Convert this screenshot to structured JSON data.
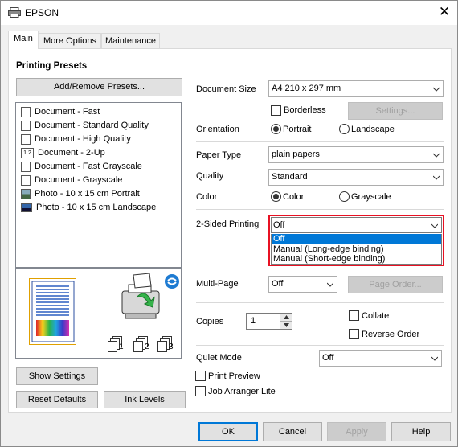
{
  "window": {
    "title": "EPSON",
    "close_label": "✕"
  },
  "tabs": [
    {
      "label": "Main"
    },
    {
      "label": "More Options"
    },
    {
      "label": "Maintenance"
    }
  ],
  "presets": {
    "heading": "Printing Presets",
    "add_remove_label": "Add/Remove Presets...",
    "items": [
      {
        "label": "Document - Fast",
        "icon": "document-icon"
      },
      {
        "label": "Document - Standard Quality",
        "icon": "document-icon"
      },
      {
        "label": "Document - High Quality",
        "icon": "document-icon"
      },
      {
        "label": "Document - 2-Up",
        "icon": "two-up-icon",
        "icon_text": "1 2"
      },
      {
        "label": "Document - Fast Grayscale",
        "icon": "document-icon"
      },
      {
        "label": "Document - Grayscale",
        "icon": "document-icon"
      },
      {
        "label": "Photo - 10 x 15 cm Portrait",
        "icon": "photo-portrait-icon"
      },
      {
        "label": "Photo - 10 x 15 cm Landscape",
        "icon": "photo-landscape-icon"
      }
    ]
  },
  "preview": {
    "copy_numbers": [
      "1",
      "2",
      "3"
    ]
  },
  "settings": {
    "document_size": {
      "label": "Document Size",
      "value": "A4 210 x 297 mm"
    },
    "borderless": {
      "label": "Borderless",
      "checked": false
    },
    "settings_button": "Settings...",
    "orientation": {
      "label": "Orientation",
      "options": [
        "Portrait",
        "Landscape"
      ],
      "selected": "Portrait"
    },
    "paper_type": {
      "label": "Paper Type",
      "value": "plain papers"
    },
    "quality": {
      "label": "Quality",
      "value": "Standard"
    },
    "color": {
      "label": "Color",
      "options": [
        "Color",
        "Grayscale"
      ],
      "selected": "Color"
    },
    "two_sided": {
      "label": "2-Sided Printing",
      "value": "Off",
      "options": [
        "Off",
        "Manual (Long-edge binding)",
        "Manual (Short-edge binding)"
      ],
      "highlighted": "Off"
    },
    "multi_page": {
      "label": "Multi-Page",
      "value": "Off"
    },
    "page_order_button": "Page Order...",
    "copies": {
      "label": "Copies",
      "value": "1"
    },
    "collate": {
      "label": "Collate",
      "checked": false
    },
    "reverse_order": {
      "label": "Reverse Order",
      "checked": false
    },
    "quiet_mode": {
      "label": "Quiet Mode",
      "value": "Off"
    },
    "print_preview": {
      "label": "Print Preview",
      "checked": false
    },
    "job_arranger": {
      "label": "Job Arranger Lite",
      "checked": false
    }
  },
  "bottom_left": {
    "show_settings": "Show Settings",
    "reset_defaults": "Reset Defaults",
    "ink_levels": "Ink Levels"
  },
  "footer": {
    "ok": "OK",
    "cancel": "Cancel",
    "apply": "Apply",
    "help": "Help"
  },
  "colors": {
    "accent": "#0078d7",
    "highlight_border": "#e81123",
    "selection": "#0078d7"
  }
}
